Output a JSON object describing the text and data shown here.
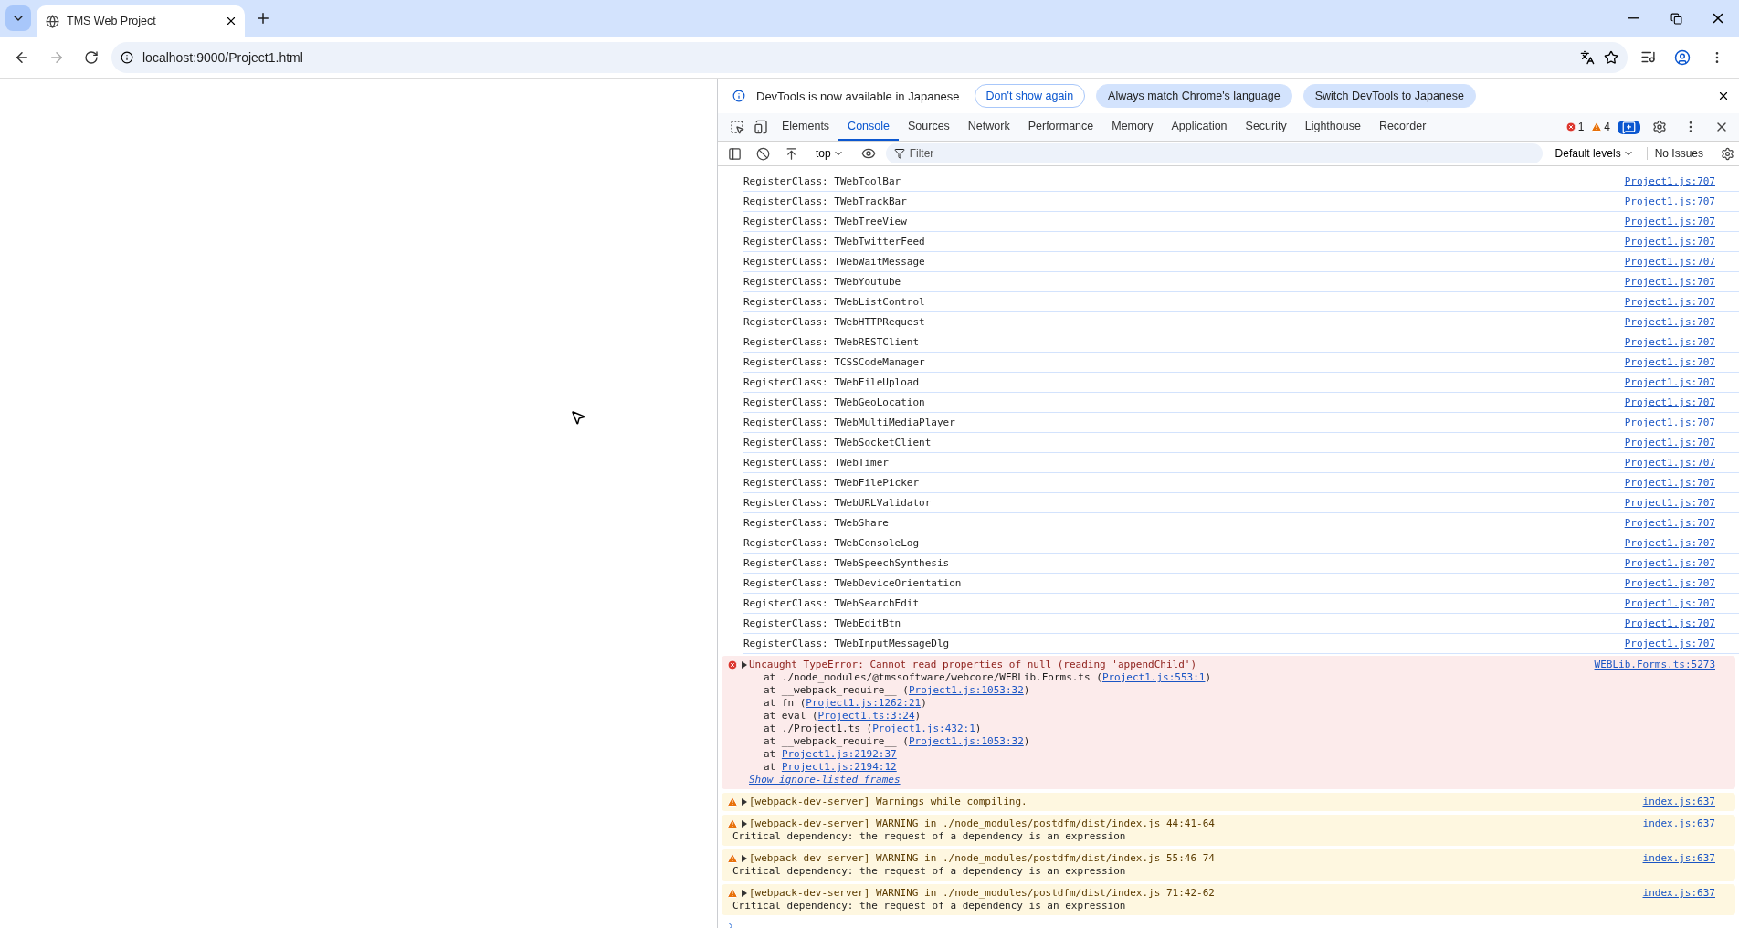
{
  "browser": {
    "tabs": [
      {
        "title": "TMS Web Project",
        "selected": true
      }
    ],
    "address": "localhost:9000/Project1.html"
  },
  "devtools": {
    "infobar": {
      "message": "DevTools is now available in Japanese",
      "buttons": [
        {
          "label": "Don't show again",
          "kind": "outline"
        },
        {
          "label": "Always match Chrome's language",
          "kind": "filled"
        },
        {
          "label": "Switch DevTools to Japanese",
          "kind": "filled"
        }
      ]
    },
    "tabs": [
      {
        "label": "Elements",
        "selected": false
      },
      {
        "label": "Console",
        "selected": true
      },
      {
        "label": "Sources",
        "selected": false
      },
      {
        "label": "Network",
        "selected": false
      },
      {
        "label": "Performance",
        "selected": false
      },
      {
        "label": "Memory",
        "selected": false
      },
      {
        "label": "Application",
        "selected": false
      },
      {
        "label": "Security",
        "selected": false
      },
      {
        "label": "Lighthouse",
        "selected": false
      },
      {
        "label": "Recorder",
        "selected": false
      }
    ],
    "error_count": "1",
    "warning_count": "4",
    "toolbar": {
      "context": "top",
      "filter_placeholder": "Filter",
      "levels": "Default levels",
      "issues": "No Issues"
    },
    "messages": [
      {
        "kind": "log",
        "text": "RegisterClass: TWebToolBar",
        "source": "Project1.js:707"
      },
      {
        "kind": "log",
        "text": "RegisterClass: TWebTrackBar",
        "source": "Project1.js:707"
      },
      {
        "kind": "log",
        "text": "RegisterClass: TWebTreeView",
        "source": "Project1.js:707"
      },
      {
        "kind": "log",
        "text": "RegisterClass: TWebTwitterFeed",
        "source": "Project1.js:707"
      },
      {
        "kind": "log",
        "text": "RegisterClass: TWebWaitMessage",
        "source": "Project1.js:707"
      },
      {
        "kind": "log",
        "text": "RegisterClass: TWebYoutube",
        "source": "Project1.js:707"
      },
      {
        "kind": "log",
        "text": "RegisterClass: TWebListControl",
        "source": "Project1.js:707"
      },
      {
        "kind": "log",
        "text": "RegisterClass: TWebHTTPRequest",
        "source": "Project1.js:707"
      },
      {
        "kind": "log",
        "text": "RegisterClass: TWebRESTClient",
        "source": "Project1.js:707"
      },
      {
        "kind": "log",
        "text": "RegisterClass: TCSSCodeManager",
        "source": "Project1.js:707"
      },
      {
        "kind": "log",
        "text": "RegisterClass: TWebFileUpload",
        "source": "Project1.js:707"
      },
      {
        "kind": "log",
        "text": "RegisterClass: TWebGeoLocation",
        "source": "Project1.js:707"
      },
      {
        "kind": "log",
        "text": "RegisterClass: TWebMultiMediaPlayer",
        "source": "Project1.js:707"
      },
      {
        "kind": "log",
        "text": "RegisterClass: TWebSocketClient",
        "source": "Project1.js:707"
      },
      {
        "kind": "log",
        "text": "RegisterClass: TWebTimer",
        "source": "Project1.js:707"
      },
      {
        "kind": "log",
        "text": "RegisterClass: TWebFilePicker",
        "source": "Project1.js:707"
      },
      {
        "kind": "log",
        "text": "RegisterClass: TWebURLValidator",
        "source": "Project1.js:707"
      },
      {
        "kind": "log",
        "text": "RegisterClass: TWebShare",
        "source": "Project1.js:707"
      },
      {
        "kind": "log",
        "text": "RegisterClass: TWebConsoleLog",
        "source": "Project1.js:707"
      },
      {
        "kind": "log",
        "text": "RegisterClass: TWebSpeechSynthesis",
        "source": "Project1.js:707"
      },
      {
        "kind": "log",
        "text": "RegisterClass: TWebDeviceOrientation",
        "source": "Project1.js:707"
      },
      {
        "kind": "log",
        "text": "RegisterClass: TWebSearchEdit",
        "source": "Project1.js:707"
      },
      {
        "kind": "log",
        "text": "RegisterClass: TWebEditBtn",
        "source": "Project1.js:707"
      },
      {
        "kind": "log",
        "text": "RegisterClass: TWebInputMessageDlg",
        "source": "Project1.js:707"
      },
      {
        "kind": "error",
        "text": "Uncaught TypeError: Cannot read properties of null (reading 'appendChild')",
        "source": "WEBLib.Forms.ts:5273",
        "stack": [
          {
            "before": "at ./node_modules/@tmssoftware/webcore/WEBLib.Forms.ts (",
            "link": "Project1.js:553:1",
            "after": ")"
          },
          {
            "before": "at __webpack_require__ (",
            "link": "Project1.js:1053:32",
            "after": ")"
          },
          {
            "before": "at fn (",
            "link": "Project1.js:1262:21",
            "after": ")"
          },
          {
            "before": "at eval (",
            "link": "Project1.ts:3:24",
            "after": ")"
          },
          {
            "before": "at ./Project1.ts (",
            "link": "Project1.js:432:1",
            "after": ")"
          },
          {
            "before": "at __webpack_require__ (",
            "link": "Project1.js:1053:32",
            "after": ")"
          },
          {
            "before": "at ",
            "link": "Project1.js:2192:37"
          },
          {
            "before": "at ",
            "link": "Project1.js:2194:12"
          }
        ],
        "more": "Show ignore-listed frames"
      },
      {
        "kind": "warning",
        "text": "[webpack-dev-server] Warnings while compiling.",
        "source": "index.js:637"
      },
      {
        "kind": "warning",
        "text": "[webpack-dev-server] WARNING in ./node_modules/postdfm/dist/index.js 44:41-64",
        "detail": "Critical dependency: the request of a dependency is an expression",
        "source": "index.js:637"
      },
      {
        "kind": "warning",
        "text": "[webpack-dev-server] WARNING in ./node_modules/postdfm/dist/index.js 55:46-74",
        "detail": "Critical dependency: the request of a dependency is an expression",
        "source": "index.js:637"
      },
      {
        "kind": "warning",
        "text": "[webpack-dev-server] WARNING in ./node_modules/postdfm/dist/index.js 71:42-62",
        "detail": "Critical dependency: the request of a dependency is an expression",
        "source": "index.js:637"
      }
    ]
  }
}
